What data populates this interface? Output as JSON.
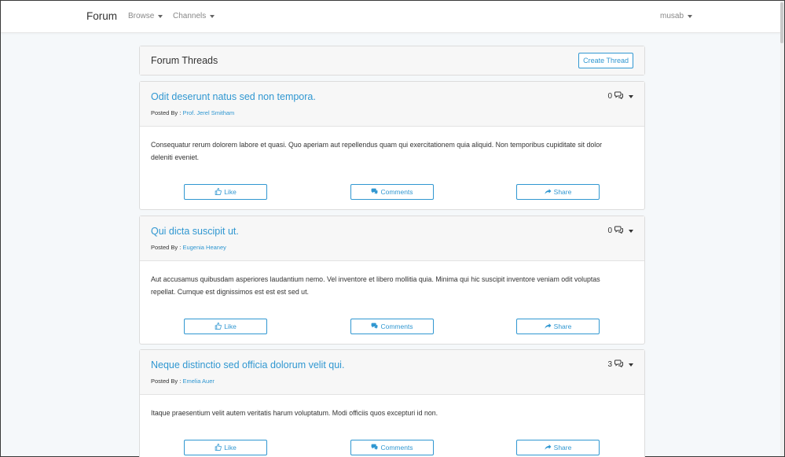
{
  "navbar": {
    "brand": "Forum",
    "browse_label": "Browse",
    "channels_label": "Channels",
    "user_label": "musab"
  },
  "header_card": {
    "title": "Forum Threads",
    "create_label": "Create Thread"
  },
  "posted_by_prefix": "Posted By : ",
  "actions": {
    "like_label": "Like",
    "comments_label": "Comments",
    "share_label": "Share"
  },
  "threads": [
    {
      "title": "Odit deserunt natus sed non tempora.",
      "author": "Prof. Jerel Smitham",
      "reply_count": "0",
      "body": "Consequatur rerum dolorem labore et quasi. Quo aperiam aut repellendus quam qui exercitationem quia aliquid. Non temporibus cupiditate sit dolor deleniti eveniet."
    },
    {
      "title": "Qui dicta suscipit ut.",
      "author": "Eugenia Heaney",
      "reply_count": "0",
      "body": "Aut accusamus quibusdam asperiores laudantium nemo. Vel inventore et libero mollitia quia. Minima qui hic suscipit inventore veniam odit voluptas repellat. Cumque est dignissimos est est est sed ut."
    },
    {
      "title": "Neque distinctio sed officia dolorum velit qui.",
      "author": "Emelia Auer",
      "reply_count": "3",
      "body": "Itaque praesentium velit autem veritatis harum voluptatum. Modi officiis quos excepturi id non."
    }
  ],
  "colors": {
    "accent": "#3097d1",
    "page_bg": "#f5f8fa",
    "card_header_bg": "#f7f7f7"
  }
}
